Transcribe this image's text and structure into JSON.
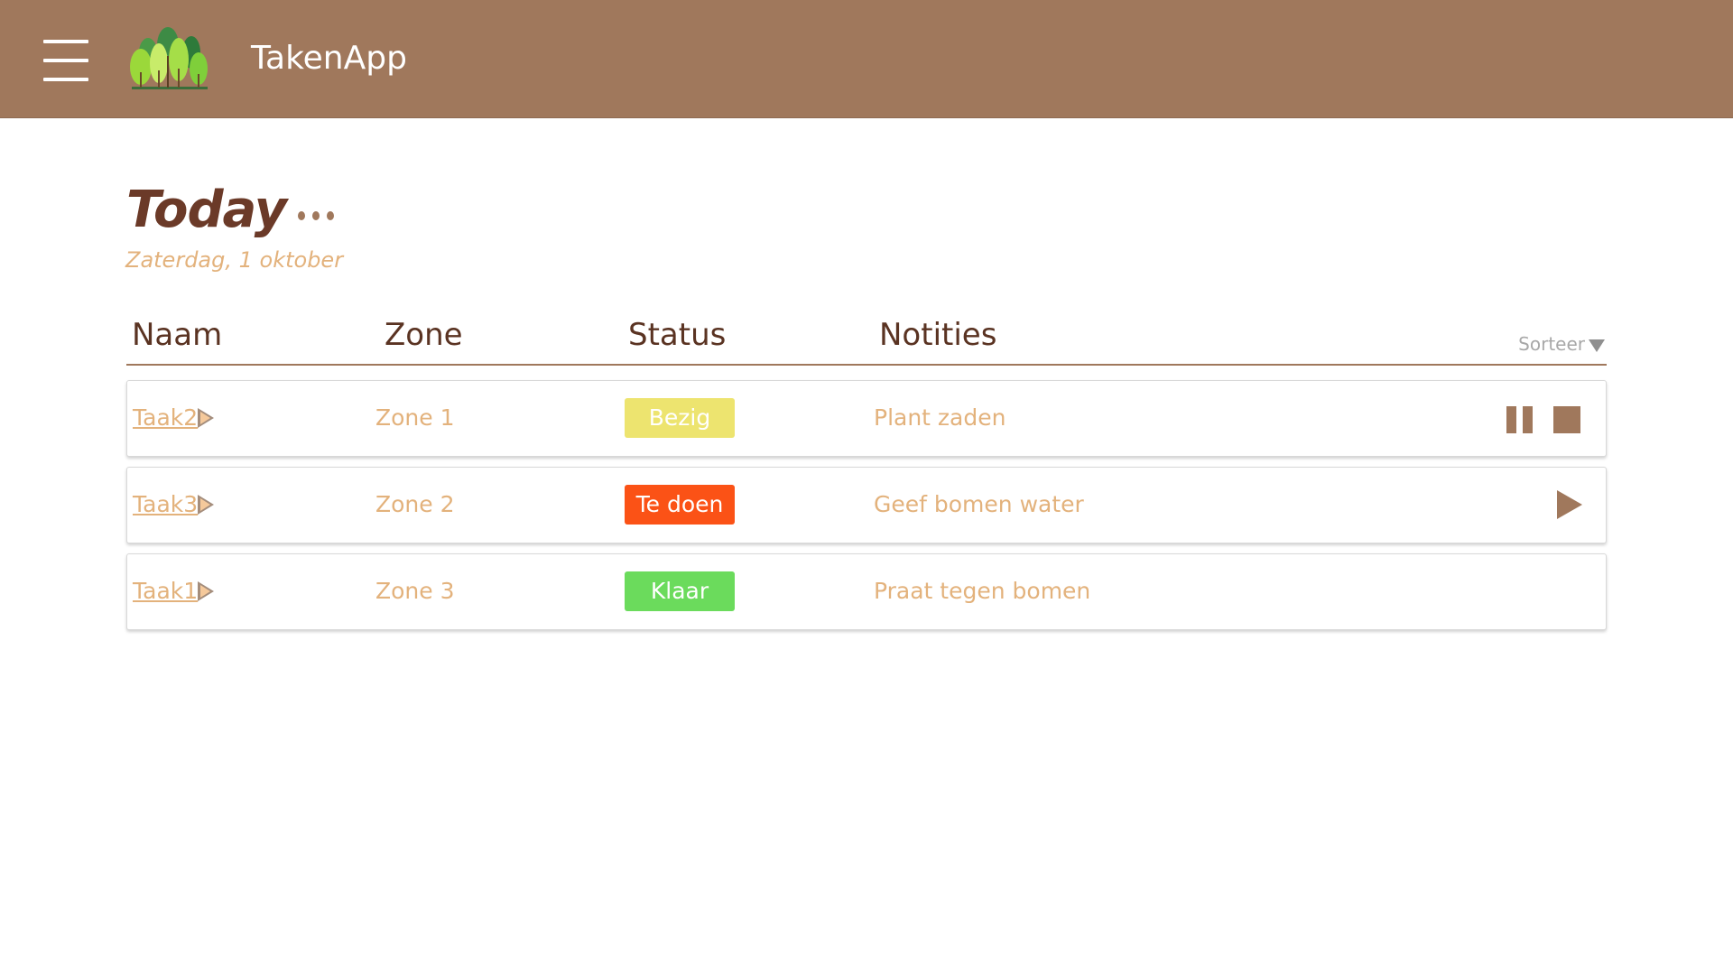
{
  "app": {
    "title": "TakenApp"
  },
  "header": {
    "menu_icon": "hamburger-menu-icon",
    "logo_icon": "trees-logo-icon"
  },
  "page": {
    "title": "Today",
    "date": "Zaterdag, 1 oktober",
    "more_icon": "more-options-icon"
  },
  "table": {
    "columns": {
      "naam": "Naam",
      "zone": "Zone",
      "status": "Status",
      "notities": "Notities"
    },
    "sort_label": "Sorteer",
    "sort_icon": "sort-down-triangle-icon",
    "rows": [
      {
        "name": "Taak2",
        "zone": "Zone 1",
        "status": "Bezig",
        "status_color": "#ede46f",
        "notes": "Plant zaden",
        "controls": [
          "pause-icon",
          "stop-icon"
        ]
      },
      {
        "name": "Taak3",
        "zone": "Zone 2",
        "status": "Te doen",
        "status_color": "#fb5216",
        "notes": "Geef bomen water",
        "controls": [
          "play-icon"
        ]
      },
      {
        "name": "Taak1",
        "zone": "Zone 3",
        "status": "Klaar",
        "status_color": "#6bdb5c",
        "notes": "Praat tegen bomen",
        "controls": []
      }
    ]
  },
  "colors": {
    "header_bg": "#a0785c",
    "title": "#6b3a28",
    "accent_text": "#e3b27c",
    "control": "#a0785c"
  }
}
